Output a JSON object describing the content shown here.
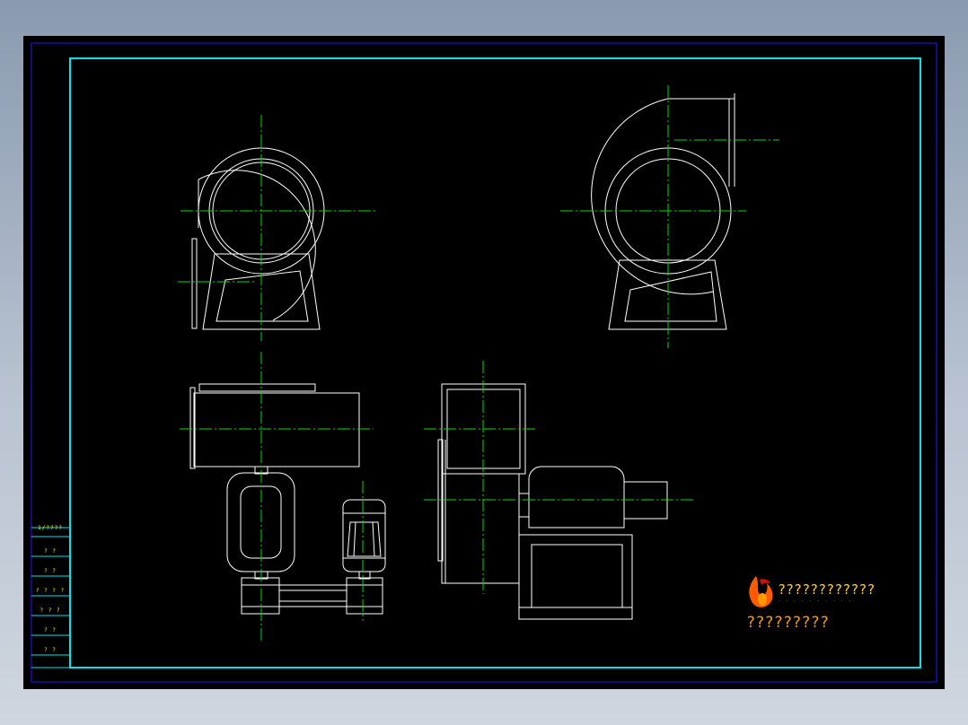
{
  "title_block": {
    "cells": [
      "1/????",
      "? ?",
      "? ?",
      "? ? ? ?",
      "? ? ?",
      "? ?",
      "? ?"
    ]
  },
  "watermark": {
    "company": "????????????",
    "company_sub": "· · · · · · · · · ·",
    "site": "?????????"
  },
  "colors": {
    "background": "#000000",
    "outer_frame": "#1a1aff",
    "inner_frame": "#00e5ee",
    "geometry": "#ffffff",
    "center_line": "#00dd00",
    "text": "#ffff00",
    "logo_flame": "#ff5a00",
    "logo_accent": "#cc1100"
  },
  "icons": {
    "logo": "flame-logo-icon"
  }
}
